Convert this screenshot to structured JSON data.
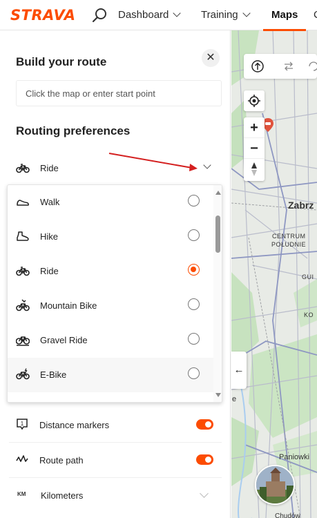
{
  "brand": {
    "logo_text": "STRAVA",
    "accent_color": "#fc4c02"
  },
  "nav": {
    "items": [
      {
        "label": "Dashboard"
      },
      {
        "label": "Training"
      },
      {
        "label": "Maps"
      }
    ],
    "cut_off": "C",
    "active": "Maps"
  },
  "panel": {
    "title": "Build your route",
    "start_placeholder": "Click the map or enter start point",
    "routing_title": "Routing preferences",
    "selected_sport": "Ride",
    "sport_options": [
      {
        "label": "Walk",
        "icon": "shoe-icon",
        "selected": false
      },
      {
        "label": "Hike",
        "icon": "hiking-boot-icon",
        "selected": false
      },
      {
        "label": "Ride",
        "icon": "bike-icon",
        "selected": true
      },
      {
        "label": "Mountain Bike",
        "icon": "mountain-bike-icon",
        "selected": false
      },
      {
        "label": "Gravel Ride",
        "icon": "gravel-bike-icon",
        "selected": false
      },
      {
        "label": "E-Bike",
        "icon": "e-bike-icon",
        "selected": false
      }
    ],
    "settings": [
      {
        "label": "Distance markers",
        "icon": "distance-marker-icon",
        "enabled": true
      },
      {
        "label": "Route path",
        "icon": "route-path-icon",
        "enabled": true
      },
      {
        "label": "Kilometers",
        "icon_text": "KM"
      }
    ]
  },
  "map": {
    "labels": {
      "city": "Zabrz",
      "district_1": "CENTRUM",
      "district_2": "POŁUDNIE",
      "gu": "GUI",
      "ko": "KO",
      "e": "e",
      "village": "Paniowki",
      "bottom": "Chudów"
    }
  }
}
